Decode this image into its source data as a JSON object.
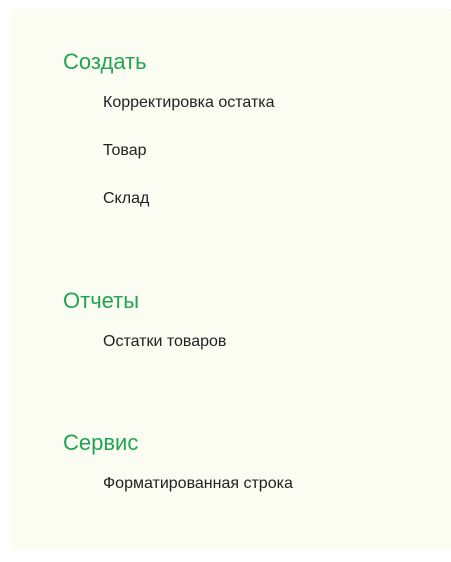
{
  "sections": [
    {
      "title": "Создать",
      "items": [
        "Корректировка остатка",
        "Товар",
        "Склад"
      ]
    },
    {
      "title": "Отчеты",
      "items": [
        "Остатки товаров"
      ]
    },
    {
      "title": "Сервис",
      "items": [
        "Форматированная строка"
      ]
    }
  ],
  "colors": {
    "background": "#fbfcf2",
    "section_title": "#21a453",
    "item_text": "#222222"
  }
}
